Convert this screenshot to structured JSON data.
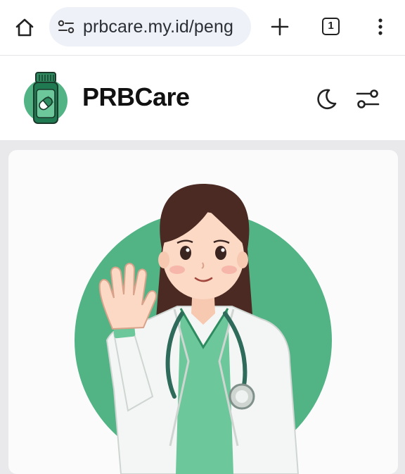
{
  "browser": {
    "url": "prbcare.my.id/peng",
    "tab_count": "1",
    "icons": [
      "home-icon",
      "site-settings-icon",
      "new-tab-plus-icon",
      "tab-switcher-icon",
      "more-vert-icon"
    ]
  },
  "site": {
    "brand": "PRBCare",
    "icons": [
      "medicine-bottle-logo",
      "moon-icon",
      "sliders-icon"
    ]
  },
  "hero": {
    "image": "doctor-waving-illustration"
  },
  "colors": {
    "accent_green": "#52b385",
    "dark_green": "#1f7a52",
    "hair_brown": "#4a2a22"
  }
}
